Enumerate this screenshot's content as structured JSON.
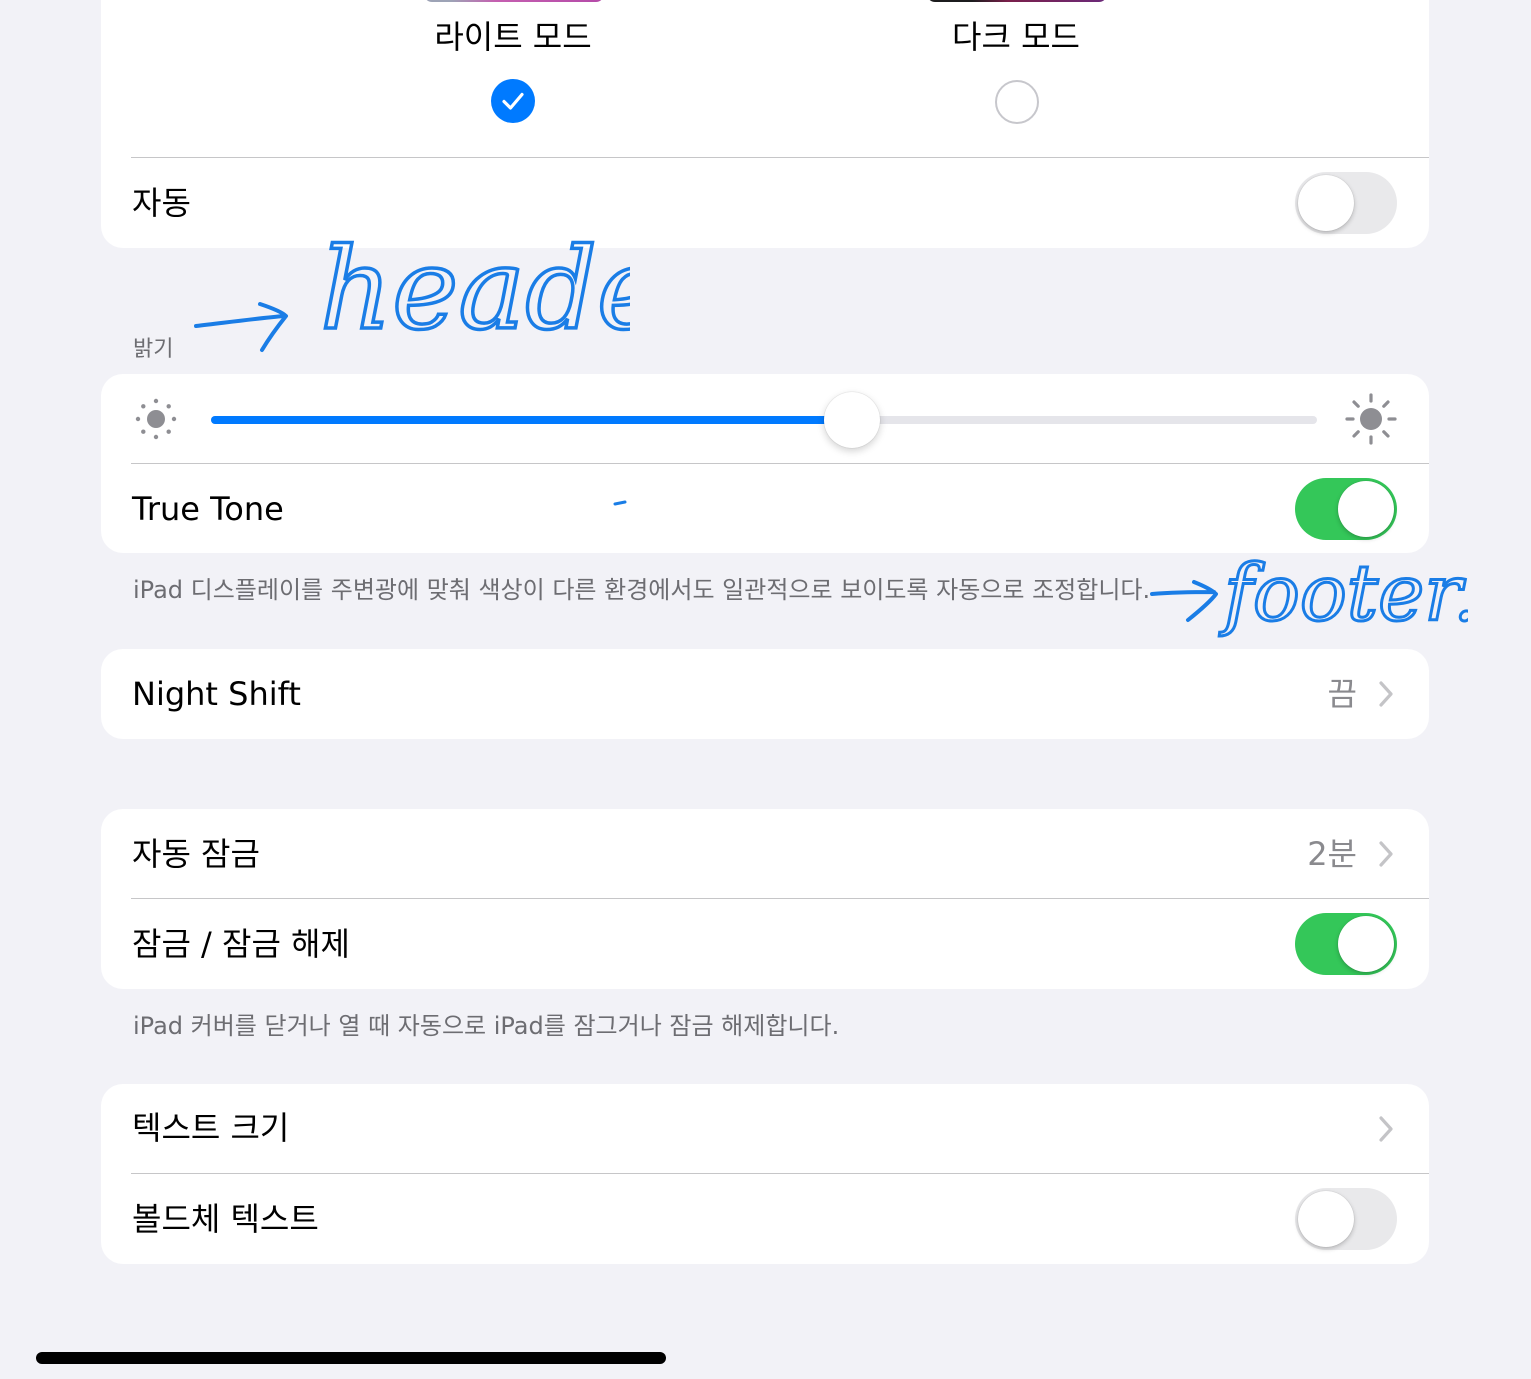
{
  "appearance": {
    "light_mode_label": "라이트 모드",
    "dark_mode_label": "다크 모드",
    "light_mode_selected": true,
    "auto_label": "자동",
    "auto_enabled": false
  },
  "brightness": {
    "header": "밝기",
    "level_fraction": 0.58,
    "true_tone_label": "True Tone",
    "true_tone_enabled": true,
    "footer": "iPad 디스플레이를 주변광에 맞춰 색상이 다른 환경에서도 일관적으로 보이도록 자동으로 조정합니다."
  },
  "night_shift": {
    "label": "Night Shift",
    "value": "끔"
  },
  "lock": {
    "auto_lock_label": "자동 잠금",
    "auto_lock_value": "2분",
    "lock_unlock_label": "잠금 / 잠금 해제",
    "lock_unlock_enabled": true,
    "footer": "iPad 커버를 닫거나 열 때 자동으로 iPad를 잠그거나 잠금 해제합니다."
  },
  "text": {
    "text_size_label": "텍스트 크기",
    "bold_text_label": "볼드체 텍스트",
    "bold_text_enabled": false
  },
  "annotations": {
    "header_note": "header",
    "footer_note": "footer."
  },
  "colors": {
    "accent_blue": "#007aff",
    "toggle_green": "#34c759",
    "annotation_blue": "#1a7de6"
  }
}
